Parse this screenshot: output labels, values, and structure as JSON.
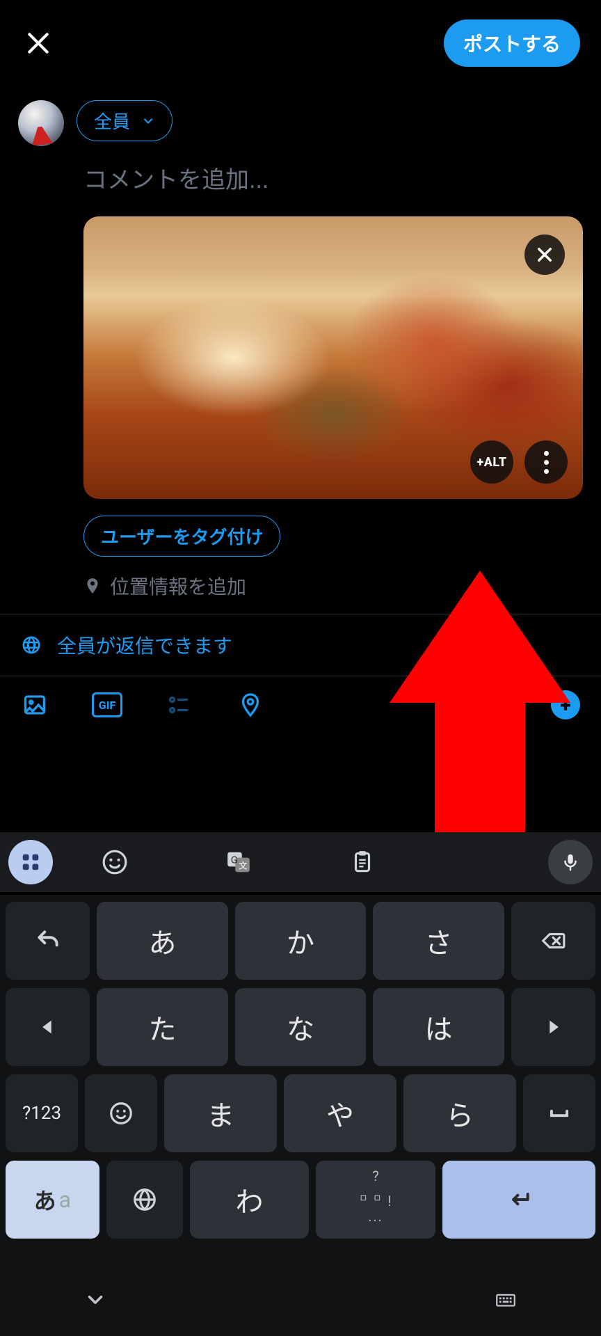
{
  "header": {
    "post_label": "ポストする"
  },
  "compose": {
    "audience_label": "全員",
    "placeholder": "コメントを追加...",
    "alt_label": "+ALT",
    "tag_users_label": "ユーザーをタグ付け",
    "add_location_label": "位置情報を追加"
  },
  "reply_settings": {
    "label": "全員が返信できます"
  },
  "toolbar": {
    "gif_label": "GIF"
  },
  "keyboard": {
    "rows": [
      [
        "あ",
        "か",
        "さ"
      ],
      [
        "た",
        "な",
        "は"
      ],
      [
        "ま",
        "や",
        "ら"
      ],
      [
        "わ"
      ]
    ],
    "mode_key": "?123",
    "lang_jp": "あ",
    "lang_en": "a",
    "sym_q": "?",
    "sym_excl": "!",
    "sym_dots": "···"
  }
}
